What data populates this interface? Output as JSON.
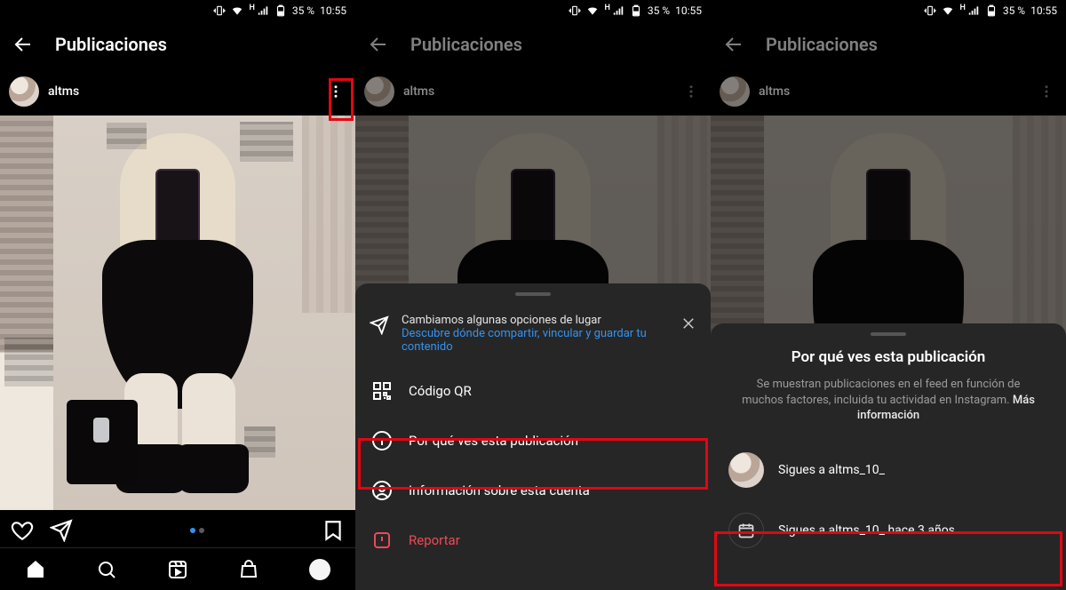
{
  "status": {
    "network": "H",
    "battery_pct": "35 %",
    "time": "10:55"
  },
  "header": {
    "title": "Publicaciones"
  },
  "post": {
    "username": "altms"
  },
  "sheet2": {
    "notice_title": "Cambiamos algunas opciones de lugar",
    "notice_link": "Descubre dónde compartir, vincular y guardar tu contenido",
    "qr_label": "Código QR",
    "why_label": "Por qué ves esta publicación",
    "about_label": "Información sobre esta cuenta",
    "report_label": "Reportar"
  },
  "sheet3": {
    "title": "Por qué ves esta publicación",
    "desc_text": "Se muestran publicaciones en el feed en función de muchos factores, incluida tu actividad en Instagram. ",
    "desc_more": "Más información",
    "reason_follow": "Sigues a altms_10_",
    "reason_since": "Sigues a altms_10_ hace 3 años"
  }
}
